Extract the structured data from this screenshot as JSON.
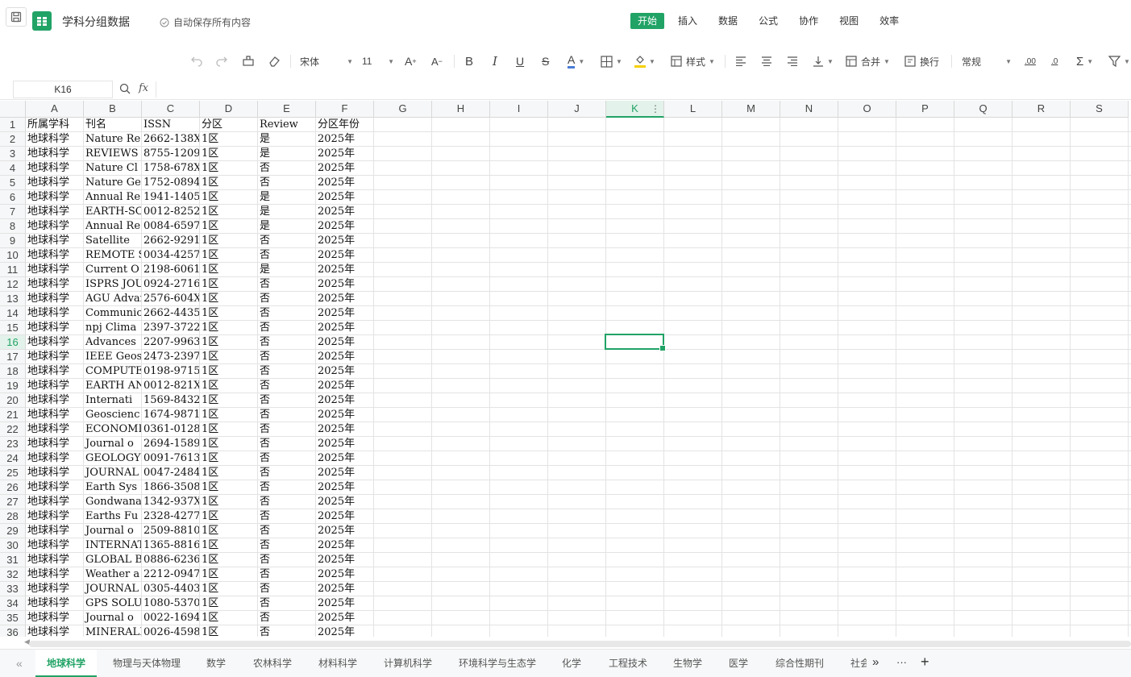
{
  "topbar": {
    "title": "学科分组数据",
    "autosave": "自动保存所有内容",
    "menu": [
      {
        "label": "开始",
        "active": true
      },
      {
        "label": "插入",
        "active": false
      },
      {
        "label": "数据",
        "active": false
      },
      {
        "label": "公式",
        "active": false
      },
      {
        "label": "协作",
        "active": false
      },
      {
        "label": "视图",
        "active": false
      },
      {
        "label": "效率",
        "active": false
      }
    ]
  },
  "toolbar": {
    "font_name": "宋体",
    "font_size": "11",
    "style_label": "样式",
    "merge_label": "合并",
    "wrap_label": "换行",
    "number_format": "常规",
    "font_color": "#4a7cd6",
    "fill_color": "#f5d000"
  },
  "formula_bar": {
    "cell_ref": "K16",
    "fx_label": "fx",
    "value": ""
  },
  "grid": {
    "columns": [
      "A",
      "B",
      "C",
      "D",
      "E",
      "F",
      "G",
      "H",
      "I",
      "J",
      "K",
      "L",
      "M",
      "N",
      "O",
      "P",
      "Q",
      "R",
      "S"
    ],
    "selected_column": "K",
    "selected_row": 16,
    "header_row": [
      "所属学科",
      "刊名",
      "ISSN",
      "分区",
      "Review",
      "分区年份"
    ],
    "rows": [
      [
        "地球科学",
        "Nature Re",
        "2662-138X",
        "1区",
        "是",
        "2025年"
      ],
      [
        "地球科学",
        "REVIEWS O",
        "8755-1209",
        "1区",
        "是",
        "2025年"
      ],
      [
        "地球科学",
        "Nature Cl",
        "1758-678X",
        "1区",
        "否",
        "2025年"
      ],
      [
        "地球科学",
        "Nature Ge",
        "1752-0894",
        "1区",
        "否",
        "2025年"
      ],
      [
        "地球科学",
        "Annual Re",
        "1941-1405",
        "1区",
        "是",
        "2025年"
      ],
      [
        "地球科学",
        "EARTH-SCI",
        "0012-8252",
        "1区",
        "是",
        "2025年"
      ],
      [
        "地球科学",
        "Annual Re",
        "0084-6597",
        "1区",
        "是",
        "2025年"
      ],
      [
        "地球科学",
        "Satellite",
        "2662-9291",
        "1区",
        "否",
        "2025年"
      ],
      [
        "地球科学",
        "REMOTE SE",
        "0034-4257",
        "1区",
        "否",
        "2025年"
      ],
      [
        "地球科学",
        "Current O",
        "2198-6061",
        "1区",
        "是",
        "2025年"
      ],
      [
        "地球科学",
        "ISPRS JOU",
        "0924-2716",
        "1区",
        "否",
        "2025年"
      ],
      [
        "地球科学",
        "AGU Advan",
        "2576-604X",
        "1区",
        "否",
        "2025年"
      ],
      [
        "地球科学",
        "Communica",
        "2662-4435",
        "1区",
        "否",
        "2025年"
      ],
      [
        "地球科学",
        "npj Clima",
        "2397-3722",
        "1区",
        "否",
        "2025年"
      ],
      [
        "地球科学",
        "Advances ",
        "2207-9963",
        "1区",
        "否",
        "2025年"
      ],
      [
        "地球科学",
        "IEEE Geos",
        "2473-2397",
        "1区",
        "否",
        "2025年"
      ],
      [
        "地球科学",
        "COMPUTERS",
        "0198-9715",
        "1区",
        "否",
        "2025年"
      ],
      [
        "地球科学",
        "EARTH AND",
        "0012-821X",
        "1区",
        "否",
        "2025年"
      ],
      [
        "地球科学",
        "Internati",
        "1569-8432",
        "1区",
        "否",
        "2025年"
      ],
      [
        "地球科学",
        "Geoscienc",
        "1674-9871",
        "1区",
        "否",
        "2025年"
      ],
      [
        "地球科学",
        "ECONOMIC ",
        "0361-0128",
        "1区",
        "否",
        "2025年"
      ],
      [
        "地球科学",
        "Journal o",
        "2694-1589",
        "1区",
        "否",
        "2025年"
      ],
      [
        "地球科学",
        "GEOLOGY  ",
        "0091-7613",
        "1区",
        "否",
        "2025年"
      ],
      [
        "地球科学",
        "JOURNAL O",
        "0047-2484",
        "1区",
        "否",
        "2025年"
      ],
      [
        "地球科学",
        "Earth Sys",
        "1866-3508",
        "1区",
        "否",
        "2025年"
      ],
      [
        "地球科学",
        "Gondwana ",
        "1342-937X",
        "1区",
        "否",
        "2025年"
      ],
      [
        "地球科学",
        "Earths Fu",
        "2328-4277",
        "1区",
        "否",
        "2025年"
      ],
      [
        "地球科学",
        "Journal o",
        "2509-8810",
        "1区",
        "否",
        "2025年"
      ],
      [
        "地球科学",
        "INTERNATI",
        "1365-8816",
        "1区",
        "否",
        "2025年"
      ],
      [
        "地球科学",
        "GLOBAL BI",
        "0886-6236",
        "1区",
        "否",
        "2025年"
      ],
      [
        "地球科学",
        "Weather a",
        "2212-0947",
        "1区",
        "否",
        "2025年"
      ],
      [
        "地球科学",
        "JOURNAL O",
        "0305-4403",
        "1区",
        "否",
        "2025年"
      ],
      [
        "地球科学",
        "GPS SOLUT",
        "1080-5370",
        "1区",
        "否",
        "2025年"
      ],
      [
        "地球科学",
        "Journal o",
        "0022-1694",
        "1区",
        "否",
        "2025年"
      ],
      [
        "地球科学",
        "MINERALIU",
        "0026-4598",
        "1区",
        "否",
        "2025年"
      ]
    ]
  },
  "sheet_tabs": {
    "tabs": [
      "地球科学",
      "物理与天体物理",
      "数学",
      "农林科学",
      "材料科学",
      "计算机科学",
      "环境科学与生态学",
      "化学",
      "工程技术",
      "生物学",
      "医学",
      "综合性期刊",
      "社会"
    ],
    "active": 0,
    "more_label": "···",
    "add_label": "+"
  }
}
